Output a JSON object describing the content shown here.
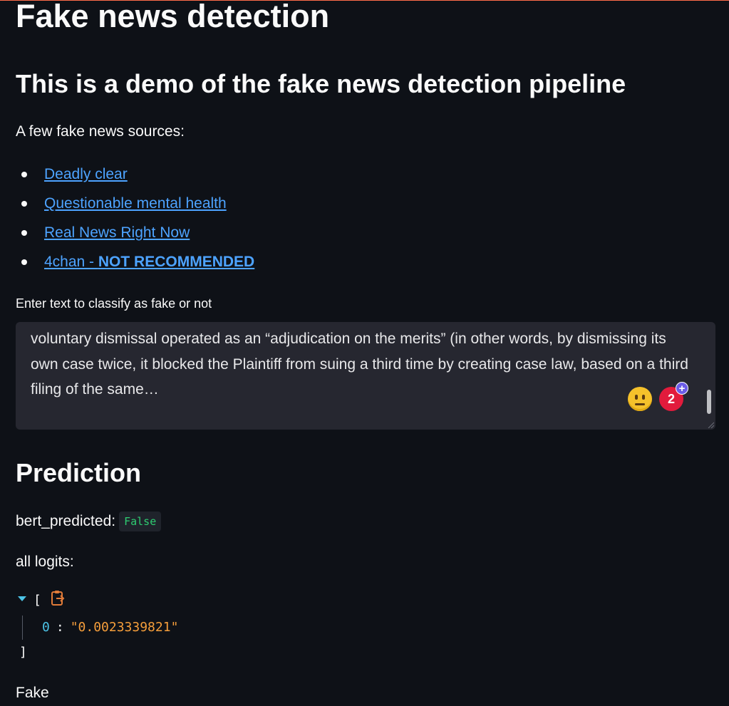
{
  "page": {
    "title": "Fake news detection",
    "subtitle": "This is a demo of the fake news detection pipeline",
    "intro": "A few fake news sources:"
  },
  "sources": [
    {
      "label": "Deadly clear"
    },
    {
      "label": "Questionable mental health"
    },
    {
      "label": "Real News Right Now"
    },
    {
      "label_prefix": "4chan - ",
      "label_bold": "NOT RECOMMENDED"
    }
  ],
  "input": {
    "label": "Enter text to classify as fake or not",
    "value": "voluntary dismissal operated as an “adjudication on the merits” (in other words, by dismissing its own case twice, it blocked the Plaintiff from suing a third time by creating case law, based on a third filing of the same…",
    "badge_count": "2",
    "badge_plus": "+"
  },
  "prediction": {
    "heading": "Prediction",
    "bert_label": "bert_predicted:",
    "bert_value": "False",
    "logits_label": "all logits:",
    "json_open": "[",
    "json_close": "]",
    "logits": [
      {
        "index": "0",
        "value": "\"0.0023339821\""
      }
    ],
    "result": "Fake"
  },
  "colors": {
    "background": "#0e1117",
    "link": "#4da3ff",
    "code_green": "#2ecc71",
    "json_key": "#4cc3e6",
    "json_string": "#f59e3b",
    "badge_red": "#e21b3c"
  },
  "icons": [
    "neutral-face-icon",
    "notification-badge-icon",
    "copy-clipboard-icon",
    "collapse-caret-icon"
  ]
}
